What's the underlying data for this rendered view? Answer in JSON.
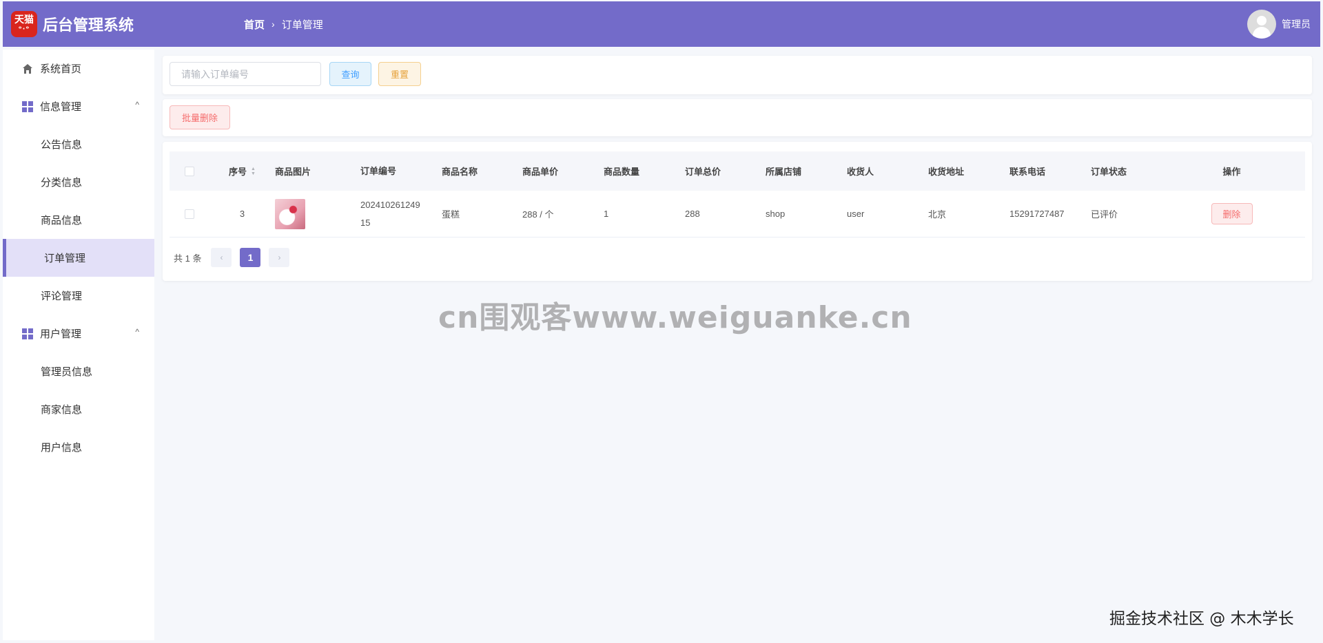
{
  "header": {
    "logo_text": "天猫",
    "logo_eyes": "ᵒ·ᵒ",
    "app_title": "后台管理系统",
    "breadcrumb_home": "首页",
    "breadcrumb_sep": "›",
    "breadcrumb_current": "订单管理",
    "user_name": "管理员",
    "accent_color": "#736bc9"
  },
  "sidebar": {
    "home": "系统首页",
    "group_info": "信息管理",
    "info_items": [
      "公告信息",
      "分类信息",
      "商品信息",
      "订单管理",
      "评论管理"
    ],
    "group_user": "用户管理",
    "user_items": [
      "管理员信息",
      "商家信息",
      "用户信息"
    ],
    "active_item": "订单管理",
    "chevron": "^"
  },
  "search": {
    "placeholder": "请输入订单编号",
    "query_label": "查询",
    "reset_label": "重置"
  },
  "actions": {
    "batch_delete_label": "批量删除"
  },
  "table": {
    "columns": [
      "序号",
      "商品图片",
      "订单编号",
      "商品名称",
      "商品单价",
      "商品数量",
      "订单总价",
      "所属店铺",
      "收货人",
      "收货地址",
      "联系电话",
      "订单状态",
      "操作"
    ],
    "rows": [
      {
        "seq": "3",
        "order_no_line1": "202410261249",
        "order_no_line2": "15",
        "name": "蛋糕",
        "price": "288 / 个",
        "qty": "1",
        "total": "288",
        "shop": "shop",
        "receiver": "user",
        "address": "北京",
        "phone": "15291727487",
        "status": "已评价",
        "delete_label": "删除"
      }
    ]
  },
  "pagination": {
    "total_text": "共 1 条",
    "prev": "‹",
    "current_page": "1",
    "next": "›"
  },
  "overlay": {
    "watermark": "cn围观客www.weiguanke.cn",
    "credit": "掘金技术社区 @ 木木学长"
  }
}
